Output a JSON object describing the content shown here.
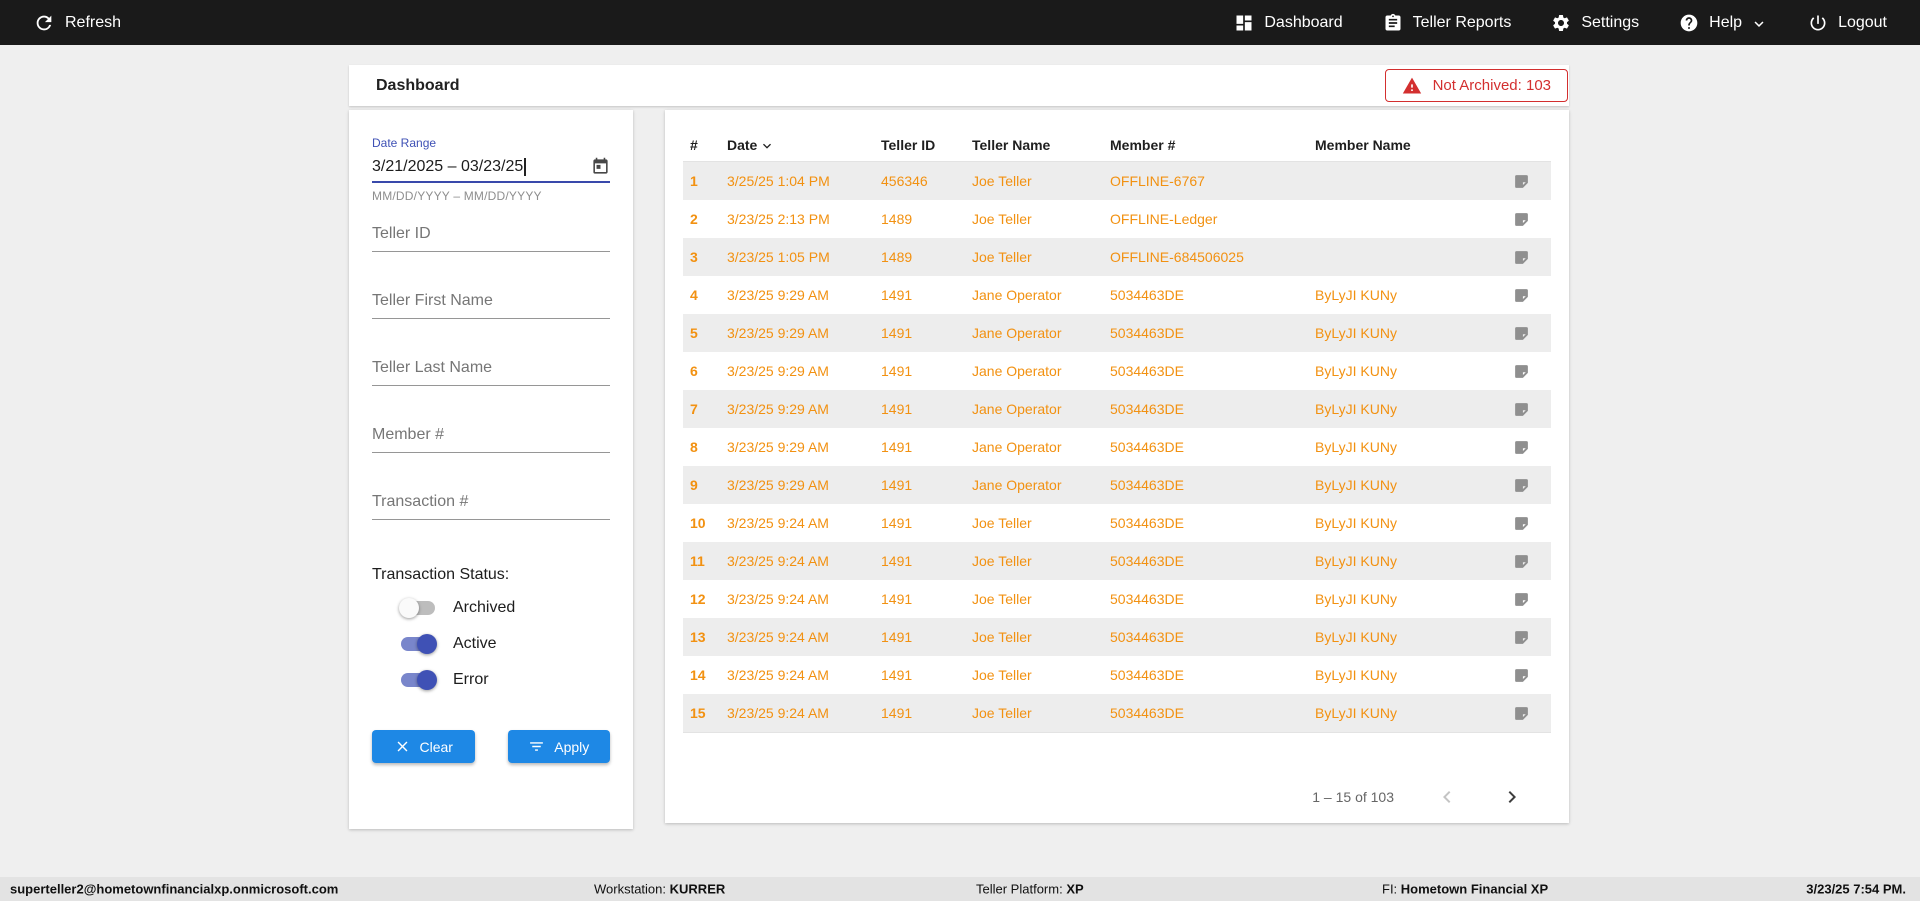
{
  "topbar": {
    "refresh_label": "Refresh",
    "nav": [
      {
        "label": "Dashboard"
      },
      {
        "label": "Teller Reports"
      },
      {
        "label": "Settings"
      },
      {
        "label": "Help"
      },
      {
        "label": "Logout"
      }
    ]
  },
  "header": {
    "title": "Dashboard",
    "not_archived_badge": "Not Archived: 103"
  },
  "filters": {
    "date_range": {
      "label": "Date Range",
      "value": "3/21/2025 – 03/23/25",
      "helper": "MM/DD/YYYY – MM/DD/YYYY"
    },
    "fields": [
      {
        "placeholder": "Teller ID"
      },
      {
        "placeholder": "Teller First Name"
      },
      {
        "placeholder": "Teller Last Name"
      },
      {
        "placeholder": "Member #"
      },
      {
        "placeholder": "Transaction #"
      }
    ],
    "status": {
      "label": "Transaction Status:",
      "toggles": [
        {
          "label": "Archived",
          "on": false
        },
        {
          "label": "Active",
          "on": true
        },
        {
          "label": "Error",
          "on": true
        }
      ]
    },
    "clear_label": "Clear",
    "apply_label": "Apply"
  },
  "table": {
    "columns": [
      "#",
      "Date",
      "Teller ID",
      "Teller Name",
      "Member #",
      "Member Name"
    ],
    "sorted_by": "Date",
    "sort_direction": "desc",
    "rows": [
      {
        "num": "1",
        "date": "3/25/25 1:04 PM",
        "teller_id": "456346",
        "teller_name": "Joe Teller",
        "member": "OFFLINE-6767",
        "member_name": ""
      },
      {
        "num": "2",
        "date": "3/23/25 2:13 PM",
        "teller_id": "1489",
        "teller_name": "Joe Teller",
        "member": "OFFLINE-Ledger",
        "member_name": ""
      },
      {
        "num": "3",
        "date": "3/23/25 1:05 PM",
        "teller_id": "1489",
        "teller_name": "Joe Teller",
        "member": "OFFLINE-684506025",
        "member_name": ""
      },
      {
        "num": "4",
        "date": "3/23/25 9:29 AM",
        "teller_id": "1491",
        "teller_name": "Jane Operator",
        "member": "5034463DE",
        "member_name": "ByLyJI KUNy"
      },
      {
        "num": "5",
        "date": "3/23/25 9:29 AM",
        "teller_id": "1491",
        "teller_name": "Jane Operator",
        "member": "5034463DE",
        "member_name": "ByLyJI KUNy"
      },
      {
        "num": "6",
        "date": "3/23/25 9:29 AM",
        "teller_id": "1491",
        "teller_name": "Jane Operator",
        "member": "5034463DE",
        "member_name": "ByLyJI KUNy"
      },
      {
        "num": "7",
        "date": "3/23/25 9:29 AM",
        "teller_id": "1491",
        "teller_name": "Jane Operator",
        "member": "5034463DE",
        "member_name": "ByLyJI KUNy"
      },
      {
        "num": "8",
        "date": "3/23/25 9:29 AM",
        "teller_id": "1491",
        "teller_name": "Jane Operator",
        "member": "5034463DE",
        "member_name": "ByLyJI KUNy"
      },
      {
        "num": "9",
        "date": "3/23/25 9:29 AM",
        "teller_id": "1491",
        "teller_name": "Jane Operator",
        "member": "5034463DE",
        "member_name": "ByLyJI KUNy"
      },
      {
        "num": "10",
        "date": "3/23/25 9:24 AM",
        "teller_id": "1491",
        "teller_name": "Joe Teller",
        "member": "5034463DE",
        "member_name": "ByLyJI KUNy"
      },
      {
        "num": "11",
        "date": "3/23/25 9:24 AM",
        "teller_id": "1491",
        "teller_name": "Joe Teller",
        "member": "5034463DE",
        "member_name": "ByLyJI KUNy"
      },
      {
        "num": "12",
        "date": "3/23/25 9:24 AM",
        "teller_id": "1491",
        "teller_name": "Joe Teller",
        "member": "5034463DE",
        "member_name": "ByLyJI KUNy"
      },
      {
        "num": "13",
        "date": "3/23/25 9:24 AM",
        "teller_id": "1491",
        "teller_name": "Joe Teller",
        "member": "5034463DE",
        "member_name": "ByLyJI KUNy"
      },
      {
        "num": "14",
        "date": "3/23/25 9:24 AM",
        "teller_id": "1491",
        "teller_name": "Joe Teller",
        "member": "5034463DE",
        "member_name": "ByLyJI KUNy"
      },
      {
        "num": "15",
        "date": "3/23/25 9:24 AM",
        "teller_id": "1491",
        "teller_name": "Joe Teller",
        "member": "5034463DE",
        "member_name": "ByLyJI KUNy"
      }
    ],
    "pagination": {
      "range_label": "1 – 15 of 103"
    }
  },
  "statusbar": {
    "user": "superteller2@hometownfinancialxp.onmicrosoft.com",
    "workstation_label": "Workstation:",
    "workstation_value": "KURRER",
    "platform_label": "Teller Platform:",
    "platform_value": "XP",
    "fi_label": "FI:",
    "fi_value": "Hometown Financial XP",
    "timestamp": "3/23/25 7:54 PM."
  },
  "colors": {
    "topbar_bg": "#1a1a1a",
    "accent_blue": "#1e88e5",
    "toggle_on_indigo": "#3f51b5",
    "row_text_orange": "#f29111",
    "alert_red": "#d32f2f"
  }
}
